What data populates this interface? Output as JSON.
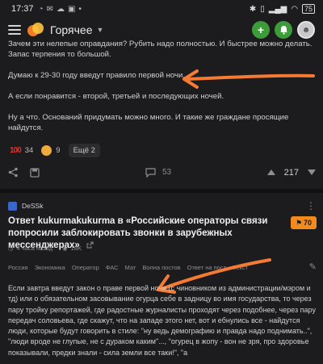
{
  "status_bar": {
    "time": "17:37",
    "battery": "75"
  },
  "header": {
    "title": "Горячее"
  },
  "post1": {
    "paragraphs": [
      "Зачем эти нелепые оправдания? Рубить надо полностью. И быстрее можно делать. Запас терпения то большой.",
      "Думаю к 29-30 году введут правило первой ночи.",
      "А если понравится - второй, третьей и последующих ночей.",
      "Ну а что. Оснований придумать можно много. И такие же граждане просящие найдутся."
    ],
    "reactions": [
      {
        "icon": "hundred-icon",
        "count": "34"
      },
      {
        "icon": "face-icon",
        "count": "9"
      }
    ],
    "more_reactions": "Ещё 2",
    "comments": "53",
    "votes": "217"
  },
  "post2": {
    "author": "DeSSk",
    "title": "Ответ kukurmakukurma в «Российские операторы связи попросили заблокировать звонки в зарубежных мессенджерах»",
    "rating": "70",
    "time": "4 часа назад",
    "views": "18K",
    "tags": [
      "Россия",
      "Экономика",
      "Оператор",
      "ФАС",
      "Мат",
      "Волна постов",
      "Ответ на пост",
      "Текст"
    ],
    "body": "Если завтра введут закон о праве первой ночи (с чиновником из администрации/мэром и тд) или о обязательном засовывание огурца себе в задницу во имя государства, то через пару тройку репортажей, где радостные журналисты проходят через подобнее, через пару передач соловьева, где скажут, что на западе этого нет, вот и ебнулись все - найдутся люди, которые будут говорить в стиле: \"ну ведь демографию и правда надо поднимать..\", \"люди вроде не глупые, не с дураком каким\"..., \"огурец в жопу - вон не зря, про здоровье показывали, предки знали - сила земли все таки!\", \"а"
  },
  "colors": {
    "background": "#1c1c1e",
    "accent_green": "#3d9c3a",
    "rating_orange": "#f28a1d",
    "arrow_orange": "#f57a34"
  }
}
